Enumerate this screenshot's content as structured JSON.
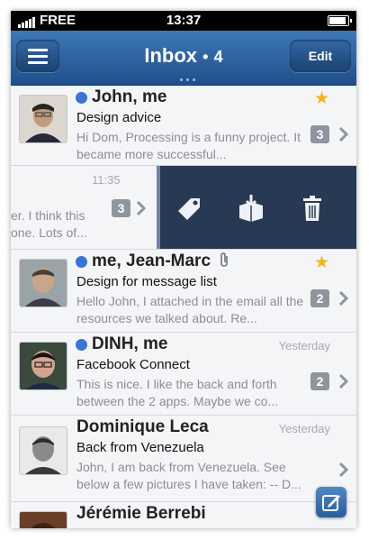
{
  "status_bar": {
    "carrier": "FREE",
    "time": "13:37"
  },
  "nav": {
    "title": "Inbox",
    "count_separator": "•",
    "count": "4",
    "edit_label": "Edit"
  },
  "icons": {
    "menu": "hamburger-menu-icon",
    "tag": "tag-icon",
    "archive": "archive-box-icon",
    "trash": "trash-icon",
    "star": "star-icon",
    "attachment": "paperclip-icon",
    "chevron": "chevron-right-icon",
    "compose": "compose-icon"
  },
  "colors": {
    "nav_bar": "#2c5f9e",
    "unread_dot": "#3a74d6",
    "star": "#f3b51c",
    "action_panel": "#283a53",
    "count_badge": "#8e959d"
  },
  "messages": [
    {
      "sender": "John, me",
      "subject": "Design advice",
      "preview": "Hi Dom, Processing is a funny project. It became more successful...",
      "date": "",
      "unread": true,
      "starred": true,
      "count": "3"
    },
    {
      "sender": "",
      "subject": "",
      "preview": "er. I think this one. Lots of...",
      "date": "11:35",
      "unread": false,
      "starred": false,
      "count": "3"
    },
    {
      "sender": "me, Jean-Marc",
      "subject": "Design for message list",
      "preview": "Hello John, I attached in the email all the resources we talked about. Re...",
      "date": "",
      "unread": true,
      "starred": true,
      "count": "2",
      "attachment": true
    },
    {
      "sender": "DINH, me",
      "subject": "Facebook Connect",
      "preview": "This is nice. I like the back and forth between the 2 apps. Maybe we co...",
      "date": "Yesterday",
      "unread": true,
      "starred": false,
      "count": "2"
    },
    {
      "sender": "Dominique Leca",
      "subject": "Back from Venezuela",
      "preview": "John, I am back from Venezuela. See below a few pictures I have taken: -- D...",
      "date": "Yesterday",
      "unread": false,
      "starred": false,
      "count": ""
    },
    {
      "sender": "Jérémie Berrebi",
      "subject": "",
      "preview": "",
      "date": "",
      "unread": false,
      "starred": false,
      "count": ""
    }
  ]
}
